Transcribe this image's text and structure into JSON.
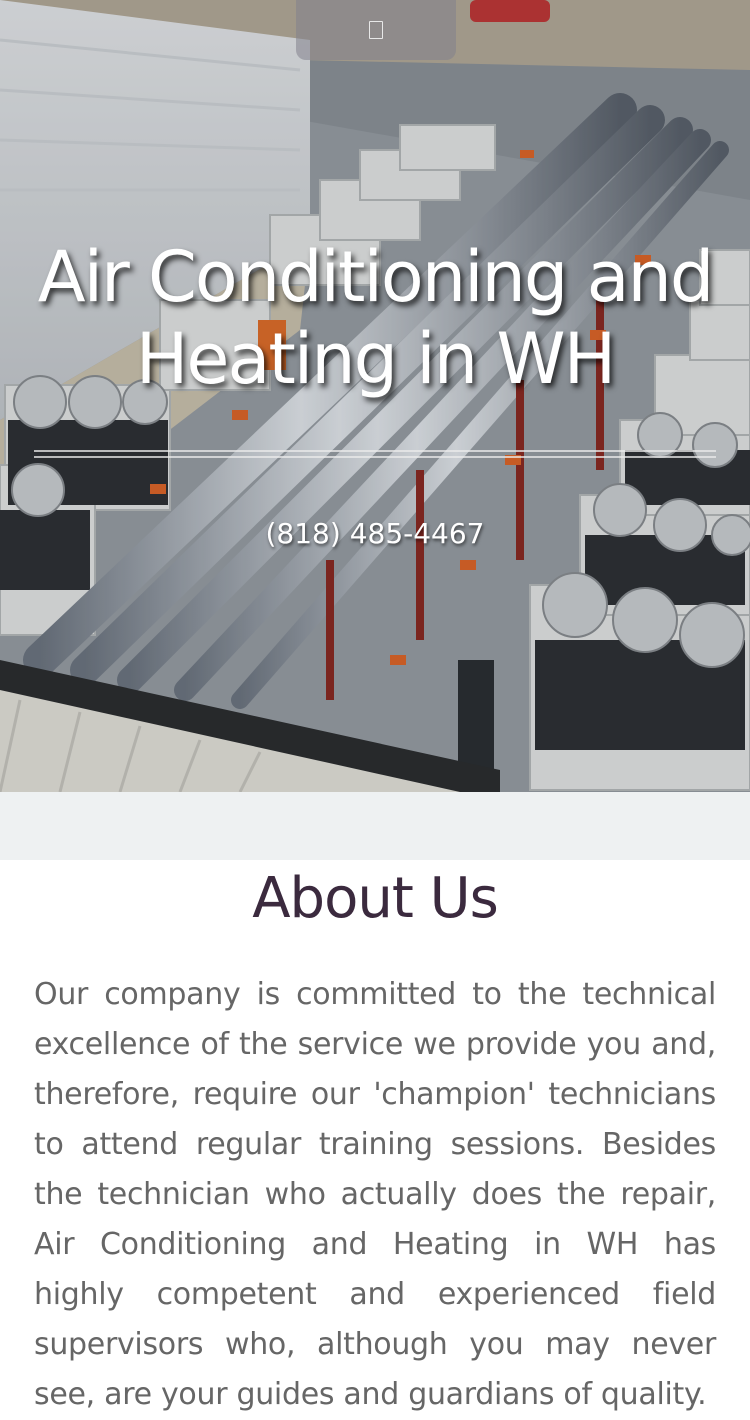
{
  "header": {
    "menu_icon": "menu-icon"
  },
  "hero": {
    "title": "Air Conditioning and Heating in WH",
    "phone": "(818) 485-4467"
  },
  "about": {
    "heading": "About Us",
    "body": "Our company is committed to the technical excellence of the service we provide you and, therefore, require our 'champion' technicians to attend regular training sessions. Besides the technician who actually does the repair, Air Conditioning and Heating in WH has highly competent and experienced field supervisors who, although you may never see, are your guides and guardians of quality."
  }
}
